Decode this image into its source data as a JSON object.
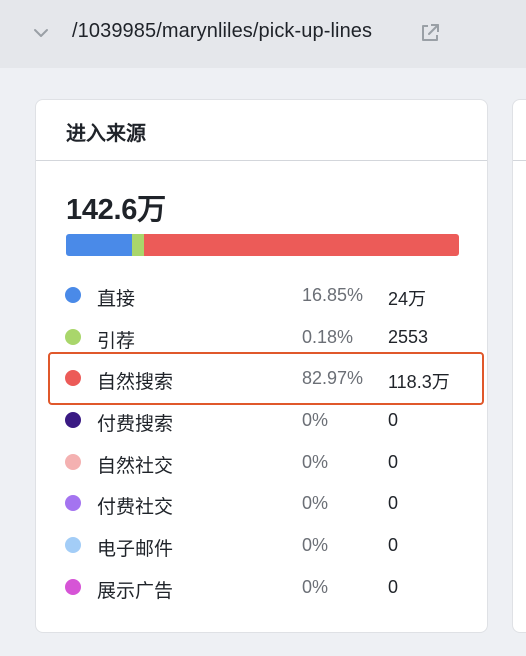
{
  "header": {
    "url_path": "/1039985/marynliles/pick-up-lines",
    "chevron_icon": "chevron-down-icon",
    "link_icon": "external-link-icon"
  },
  "card": {
    "title": "进入来源",
    "total": "142.6万",
    "sources": [
      {
        "label": "直接",
        "percent": "16.85%",
        "value": "24万",
        "color": "#4a8ae8",
        "share": 0.1685
      },
      {
        "label": "引荐",
        "percent": "0.18%",
        "value": "2553",
        "color": "#a9d66b",
        "share": 0.0018
      },
      {
        "label": "自然搜索",
        "percent": "82.97%",
        "value": "118.3万",
        "color": "#ec5b58",
        "share": 0.8297
      },
      {
        "label": "付费搜索",
        "percent": "0%",
        "value": "0",
        "color": "#3a1a83",
        "share": 0
      },
      {
        "label": "自然社交",
        "percent": "0%",
        "value": "0",
        "color": "#f4b1b1",
        "share": 0
      },
      {
        "label": "付费社交",
        "percent": "0%",
        "value": "0",
        "color": "#a474f0",
        "share": 0
      },
      {
        "label": "电子邮件",
        "percent": "0%",
        "value": "0",
        "color": "#a3cdf7",
        "share": 0
      },
      {
        "label": "展示广告",
        "percent": "0%",
        "value": "0",
        "color": "#d654d6",
        "share": 0
      }
    ],
    "highlighted_source": "自然搜索"
  }
}
